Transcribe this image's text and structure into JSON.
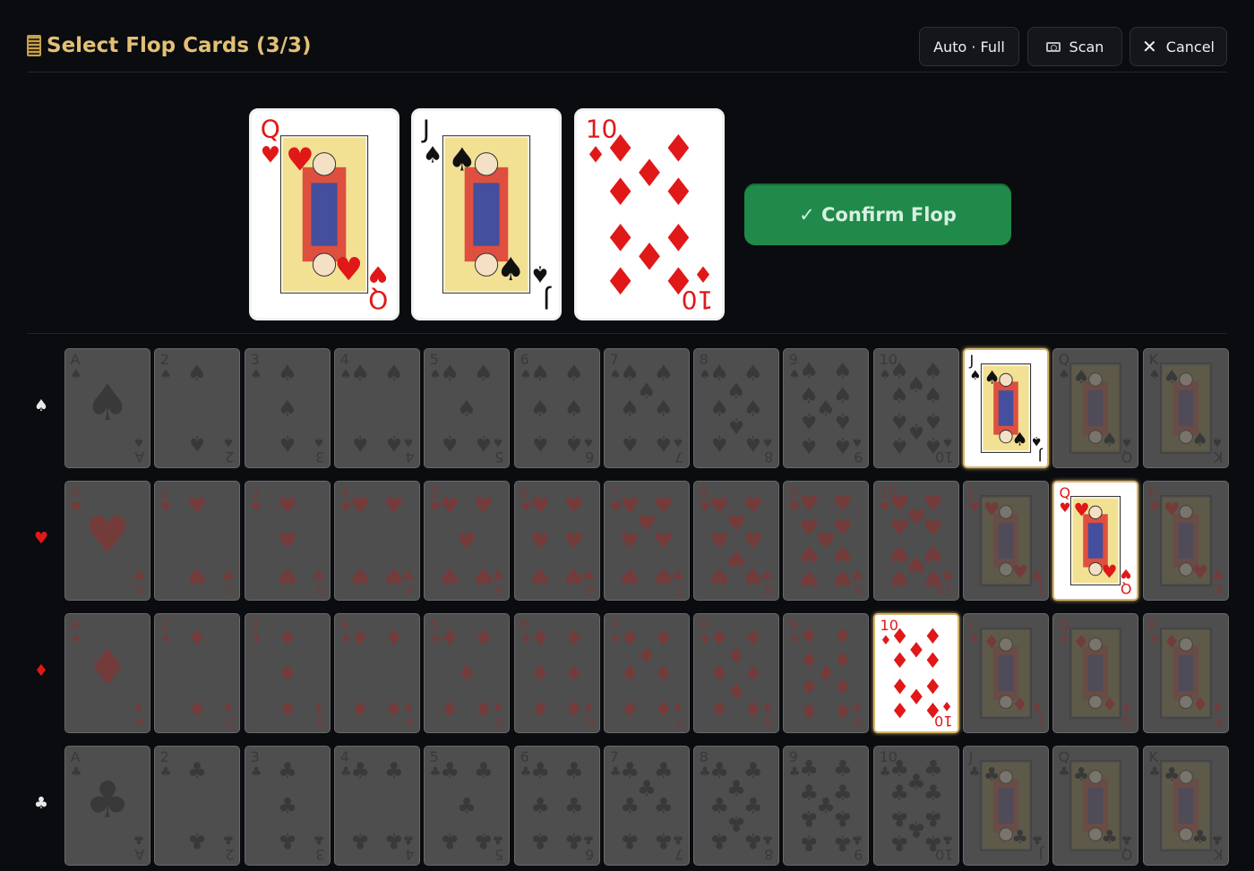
{
  "header": {
    "title": "Select Flop Cards (3/3)",
    "auto_label": "Auto · Full",
    "scan_label": "Scan",
    "cancel_label": "Cancel"
  },
  "selected_cards": [
    {
      "rank": "Q",
      "suit": "hearts"
    },
    {
      "rank": "J",
      "suit": "spades"
    },
    {
      "rank": "10",
      "suit": "diamonds"
    }
  ],
  "confirm_label": "✓ Confirm Flop",
  "suit_rows": [
    {
      "suit": "spades",
      "symbol": "♠",
      "color": "#000000"
    },
    {
      "suit": "hearts",
      "symbol": "♥",
      "color": "#e01818"
    },
    {
      "suit": "diamonds",
      "symbol": "♦",
      "color": "#e01818"
    },
    {
      "suit": "clubs",
      "symbol": "♣",
      "color": "#000000"
    }
  ],
  "ranks": [
    "A",
    "2",
    "3",
    "4",
    "5",
    "6",
    "7",
    "8",
    "9",
    "10",
    "J",
    "Q",
    "K"
  ],
  "colors": {
    "accent": "#e3c074",
    "confirm": "#1f8a4a",
    "red": "#e01818"
  }
}
